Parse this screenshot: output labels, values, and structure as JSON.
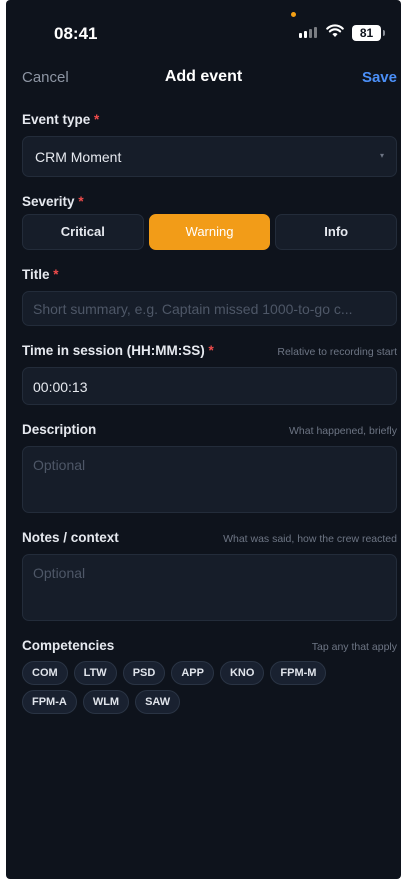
{
  "status_bar": {
    "time": "08:41",
    "battery": "81"
  },
  "nav": {
    "cancel": "Cancel",
    "title": "Add event",
    "save": "Save"
  },
  "event_type": {
    "label": "Event type",
    "required": "*",
    "value": "CRM Moment",
    "caret": "▾"
  },
  "severity": {
    "label": "Severity",
    "required": "*",
    "options": [
      "Critical",
      "Warning",
      "Info"
    ],
    "selected": "Warning",
    "active_color": "#f29c18"
  },
  "title_field": {
    "label": "Title",
    "required": "*",
    "placeholder": "Short summary, e.g. Captain missed 1000-to-go c..."
  },
  "time": {
    "label": "Time in session (HH:MM:SS)",
    "required": "*",
    "hint": "Relative to recording start",
    "value": "00:00:13"
  },
  "description": {
    "label": "Description",
    "hint": "What happened, briefly",
    "placeholder": "Optional"
  },
  "notes": {
    "label": "Notes / context",
    "hint": "What was said, how the crew reacted",
    "placeholder": "Optional"
  },
  "competencies": {
    "label": "Competencies",
    "hint": "Tap any that apply",
    "chips": [
      "COM",
      "LTW",
      "PSD",
      "APP",
      "KNO",
      "FPM-M",
      "FPM-A",
      "WLM",
      "SAW"
    ]
  },
  "colors": {
    "background": "#0e131c",
    "field": "#161d29",
    "accent_blue": "#4b8ff7",
    "required_red": "#ef4b4b"
  },
  "icons": {
    "signal": "cellular-signal-icon",
    "wifi": "wifi-icon",
    "battery": "battery-icon",
    "dropdown": "chevron-down-icon"
  }
}
